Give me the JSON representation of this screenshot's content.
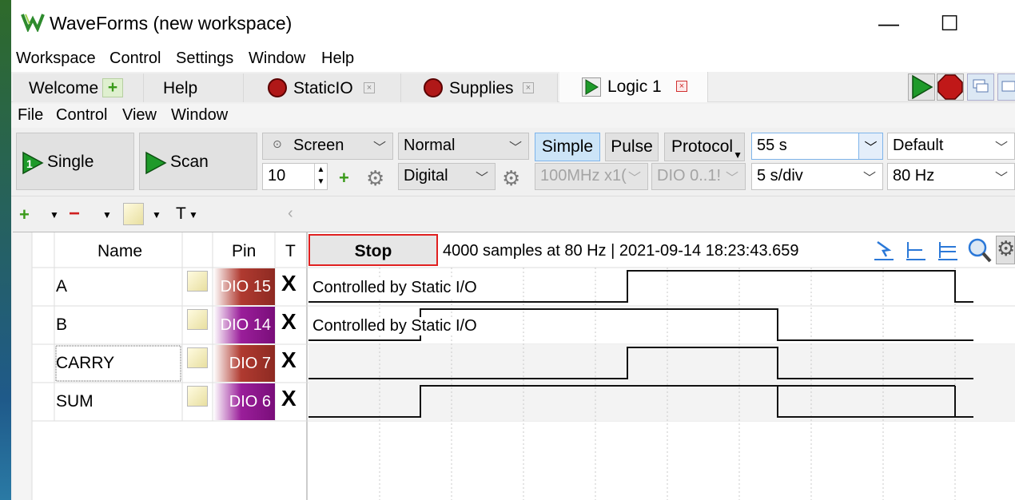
{
  "app": {
    "title": "WaveForms (new workspace)",
    "minimize": "—",
    "maximize": "☐"
  },
  "main_menu": [
    "Workspace",
    "Control",
    "Settings",
    "Window",
    "Help"
  ],
  "tabs": [
    {
      "label": "Welcome",
      "icon": "plus-icon"
    },
    {
      "label": "Help"
    },
    {
      "label": "StaticIO",
      "icon": "stop-red-icon"
    },
    {
      "label": "Supplies",
      "icon": "stop-red-icon"
    },
    {
      "label": "Logic 1",
      "icon": "play-green-icon"
    }
  ],
  "sub_menu": [
    "File",
    "Control",
    "View",
    "Window"
  ],
  "toolbar": {
    "single_label": "Single",
    "scan_label": "Scan",
    "screen_mode": "Screen",
    "count": "10",
    "trigger_mode": "Normal",
    "type": "Digital",
    "simple_label": "Simple",
    "pulse_label": "Pulse",
    "protocol_label": "Protocol",
    "clock": "100MHz x1(",
    "dio_range": "DIO 0..1!",
    "position": "55 s",
    "base": "5 s/div",
    "preset": "Default",
    "rate": "80 Hz"
  },
  "channel_toolbar": {
    "text_menu": "T"
  },
  "grid": {
    "headers": {
      "name": "Name",
      "pin": "Pin",
      "t": "T"
    },
    "stop_label": "Stop",
    "info": "4000 samples at 80 Hz | 2021-09-14 18:23:43.659",
    "controlled_text": "Controlled by Static I/O",
    "channels": [
      {
        "name": "A",
        "pin": "DIO 15",
        "t": "X",
        "color": "#a0302a"
      },
      {
        "name": "B",
        "pin": "DIO 14",
        "t": "X",
        "color": "#8a1a8a"
      },
      {
        "name": "CARRY",
        "pin": "DIO 7",
        "t": "X",
        "color": "#a0302a"
      },
      {
        "name": "SUM",
        "pin": "DIO 6",
        "t": "X",
        "color": "#8a1a8a"
      }
    ]
  }
}
